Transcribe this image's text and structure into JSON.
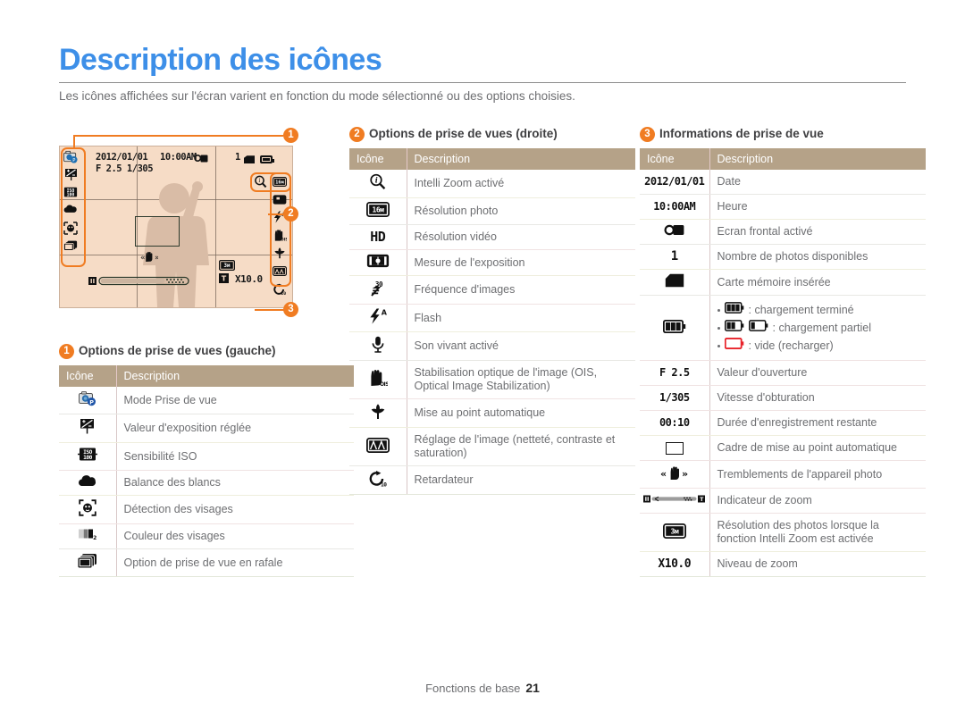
{
  "page": {
    "title": "Description des icônes",
    "intro": "Les icônes affichées sur l'écran varient en fonction du mode sélectionné ou des options choisies.",
    "footer_label": "Fonctions de base",
    "footer_page": "21",
    "accent_color": "#f07c22",
    "title_color": "#3d8fe8",
    "table_header_color": "#b5a288",
    "lcd_color": "#f6dcc6"
  },
  "lcd": {
    "date": "2012/01/01",
    "time": "10:00AM",
    "exposure": "F 2.5 1/305",
    "shots_remaining": "1",
    "zoom_level": "X10.0",
    "intelli_zoom_res": "3м",
    "left_icons": [
      "shooting-mode-icon",
      "exposure-value-icon",
      "iso-icon",
      "white-balance-icon",
      "face-detection-icon",
      "burst-icon"
    ],
    "right_icons": [
      "intelli-zoom-icon",
      "photo-resolution-icon",
      "video-resolution-icon",
      "flash-auto-icon",
      "ois-icon",
      "macro-af-icon",
      "image-adjust-icon",
      "timer-icon"
    ],
    "callouts": [
      {
        "number": "1",
        "target": "left-icon-column"
      },
      {
        "number": "2",
        "target": "right-icon-column"
      },
      {
        "number": "3",
        "target": "shooting-information"
      }
    ]
  },
  "sections": [
    {
      "id": "left",
      "badge": "1",
      "title": "Options de prise de vues (gauche)",
      "columns": [
        "Icône",
        "Description"
      ],
      "rows": [
        {
          "icon": "shooting-mode-icon",
          "icon_text": "",
          "desc": "Mode Prise de vue"
        },
        {
          "icon": "exposure-value-icon",
          "icon_text": "",
          "desc": "Valeur d'exposition réglée"
        },
        {
          "icon": "iso-icon",
          "icon_text": "",
          "desc": "Sensibilité ISO"
        },
        {
          "icon": "white-balance-icon",
          "icon_text": "",
          "desc": "Balance des blancs"
        },
        {
          "icon": "face-detection-icon",
          "icon_text": "",
          "desc": "Détection des visages"
        },
        {
          "icon": "face-tone-icon",
          "icon_text": "",
          "desc": "Couleur des visages"
        },
        {
          "icon": "burst-icon",
          "icon_text": "",
          "desc": "Option de prise de vue en rafale"
        }
      ]
    },
    {
      "id": "middle",
      "badge": "2",
      "title": "Options de prise de vues (droite)",
      "columns": [
        "Icône",
        "Description"
      ],
      "rows": [
        {
          "icon": "intelli-zoom-icon",
          "icon_text": "",
          "desc": "Intelli Zoom activé"
        },
        {
          "icon": "photo-resolution-icon",
          "icon_text": "16м",
          "desc": "Résolution photo"
        },
        {
          "icon": "video-resolution-icon",
          "icon_text": "HD",
          "desc": "Résolution vidéo"
        },
        {
          "icon": "metering-icon",
          "icon_text": "",
          "desc": "Mesure de l'exposition"
        },
        {
          "icon": "frame-rate-icon",
          "icon_text": "30",
          "desc": "Fréquence d'images"
        },
        {
          "icon": "flash-auto-icon",
          "icon_text": "",
          "desc": "Flash"
        },
        {
          "icon": "live-sound-icon",
          "icon_text": "",
          "desc": "Son vivant activé"
        },
        {
          "icon": "ois-icon",
          "icon_text": "",
          "desc": "Stabilisation optique de l'image (OIS, Optical Image Stabilization)"
        },
        {
          "icon": "macro-af-icon",
          "icon_text": "",
          "desc": "Mise au point automatique"
        },
        {
          "icon": "image-adjust-icon",
          "icon_text": "",
          "desc": "Réglage de l'image (netteté, contraste et saturation)"
        },
        {
          "icon": "timer-icon",
          "icon_text": "",
          "desc": "Retardateur"
        }
      ]
    },
    {
      "id": "right",
      "badge": "3",
      "title": "Informations de prise de vue",
      "columns": [
        "Icône",
        "Description"
      ],
      "rows": [
        {
          "icon": "date-text",
          "icon_text": "2012/01/01",
          "desc": "Date"
        },
        {
          "icon": "time-text",
          "icon_text": "10:00AM",
          "desc": "Heure"
        },
        {
          "icon": "front-display-icon",
          "icon_text": "",
          "desc": "Ecran frontal activé"
        },
        {
          "icon": "shot-count-text",
          "icon_text": "1",
          "desc": "Nombre de photos disponibles"
        },
        {
          "icon": "memory-card-icon",
          "icon_text": "",
          "desc": "Carte mémoire insérée"
        },
        {
          "icon": "battery-icon",
          "icon_text": "",
          "desc": "",
          "bullets": [
            {
              "glyph": "battery-full-icon",
              "text": ": chargement terminé"
            },
            {
              "glyph": "battery-partial-icon",
              "text": ": chargement partiel"
            },
            {
              "glyph": "battery-empty-icon",
              "text": ": vide (recharger)"
            }
          ]
        },
        {
          "icon": "aperture-text",
          "icon_text": "F 2.5",
          "desc": "Valeur d'ouverture"
        },
        {
          "icon": "shutter-speed-text",
          "icon_text": "1/305",
          "desc": "Vitesse d'obturation"
        },
        {
          "icon": "record-time-text",
          "icon_text": "00:10",
          "desc": "Durée d'enregistrement restante"
        },
        {
          "icon": "af-frame-icon",
          "icon_text": "",
          "desc": "Cadre de mise au point automatique"
        },
        {
          "icon": "camera-shake-icon",
          "icon_text": "",
          "desc": "Tremblements de l'appareil photo"
        },
        {
          "icon": "zoom-indicator-icon",
          "icon_text": "",
          "desc": "Indicateur de zoom"
        },
        {
          "icon": "intelli-zoom-res-icon",
          "icon_text": "3м",
          "desc": "Résolution des photos lorsque la fonction Intelli Zoom est activée"
        },
        {
          "icon": "zoom-level-text",
          "icon_text": "X10.0",
          "desc": "Niveau de zoom"
        }
      ]
    }
  ]
}
